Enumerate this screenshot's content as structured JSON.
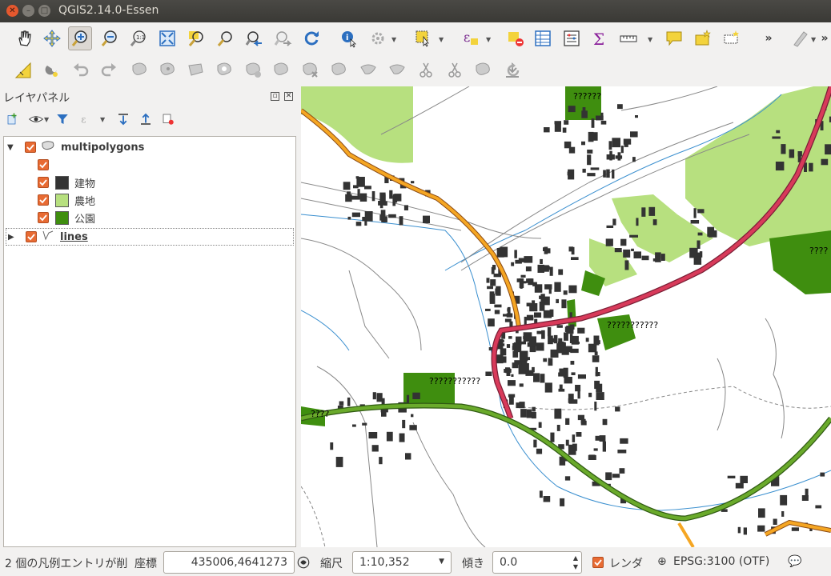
{
  "window": {
    "title": "QGIS2.14.0-Essen"
  },
  "toolbar_icons": [
    "pan-icon",
    "pan-to-selection-icon",
    "zoom-in-icon",
    "zoom-out-icon",
    "zoom-actual-icon",
    "zoom-full-icon",
    "zoom-selection-icon",
    "zoom-layer-icon",
    "zoom-last-icon",
    "zoom-next-icon",
    "refresh-icon",
    "identify-icon",
    "run-action-icon",
    "select-features-icon",
    "select-by-expression-icon",
    "deselect-icon",
    "attribute-table-icon",
    "field-calculator-icon",
    "statistics-icon",
    "measure-icon",
    "map-tips-icon",
    "new-bookmark-icon",
    "show-bookmarks-icon",
    "more-icon",
    "digitize-pen-icon"
  ],
  "panel": {
    "title": "レイヤパネル",
    "layers": [
      {
        "name": "multipolygons",
        "categories": [
          {
            "label": "",
            "color": ""
          },
          {
            "label": "建物",
            "color": "#333333"
          },
          {
            "label": "農地",
            "color": "#b7e07f"
          },
          {
            "label": "公園",
            "color": "#3f8e0f"
          }
        ]
      },
      {
        "name": "lines"
      }
    ]
  },
  "map": {
    "labels": [
      "??????",
      "???????????",
      "???????????",
      "????",
      "????"
    ],
    "colors": {
      "background": "#ffffff",
      "buildings": "#333333",
      "farmland": "#b7e07f",
      "park": "#3f8e0f",
      "road_orange": "#f5a623",
      "road_red": "#d83a5a",
      "road_green": "#6aaa2b",
      "river": "#3a8fcf"
    }
  },
  "status": {
    "message": "2 個の凡例エントリが削",
    "coord_label": "座標",
    "coord_value": "435006,4641273",
    "scale_label": "縮尺",
    "scale_value": "1:10,352",
    "rotation_label": "傾き",
    "rotation_value": "0.0",
    "render_label": "レンダ",
    "crs": "EPSG:3100 (OTF)"
  }
}
